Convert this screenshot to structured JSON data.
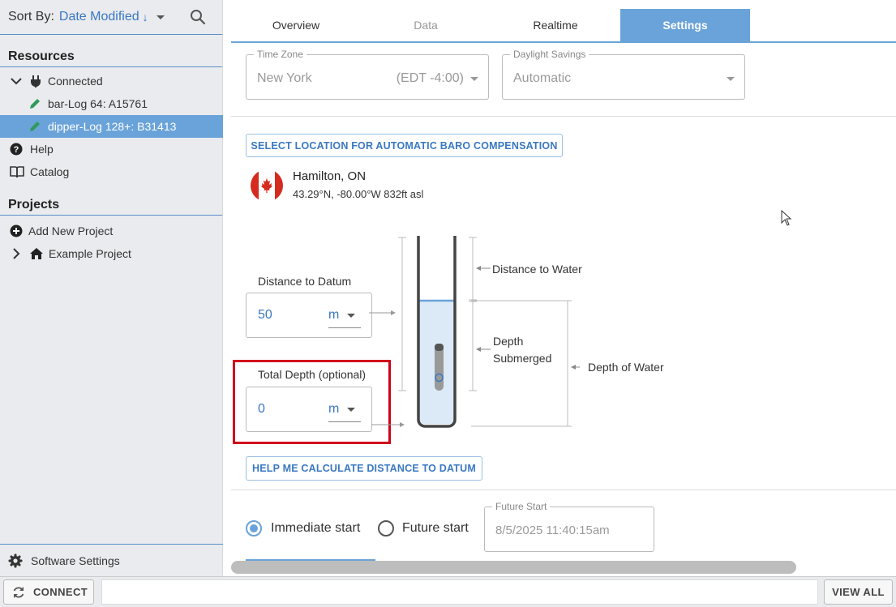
{
  "sidebar": {
    "sort": {
      "label": "Sort By:",
      "value": "Date Modified",
      "direction": "↓"
    },
    "resources_title": "Resources",
    "connected": "Connected",
    "devices": [
      {
        "label": "bar-Log 64: A15761",
        "selected": false
      },
      {
        "label": "dipper-Log 128+: B31413",
        "selected": true
      }
    ],
    "help": "Help",
    "catalog": "Catalog",
    "projects_title": "Projects",
    "add_project": "Add New Project",
    "example_project": "Example Project",
    "software_settings": "Software Settings"
  },
  "tabs": [
    {
      "label": "Overview",
      "state": "normal"
    },
    {
      "label": "Data",
      "state": "disabled"
    },
    {
      "label": "Realtime",
      "state": "normal"
    },
    {
      "label": "Settings",
      "state": "active"
    }
  ],
  "timezone": {
    "legend": "Time Zone",
    "value": "New York",
    "offset": "(EDT -4:00)"
  },
  "daylight": {
    "legend": "Daylight Savings",
    "value": "Automatic"
  },
  "baro_button": "SELECT LOCATION FOR AUTOMATIC BARO COMPENSATION",
  "location": {
    "name": "Hamilton, ON",
    "coords": "43.29°N, -80.00°W 832ft asl"
  },
  "distance_to_datum": {
    "label": "Distance to Datum",
    "value": "50",
    "unit": "m"
  },
  "total_depth": {
    "label": "Total Depth (optional)",
    "value": "0",
    "unit": "m"
  },
  "diagram": {
    "distance_to_water": "Distance to Water",
    "depth_submerged_1": "Depth",
    "depth_submerged_2": "Submerged",
    "depth_of_water": "Depth of Water"
  },
  "help_button": "HELP ME CALCULATE DISTANCE TO DATUM",
  "start": {
    "immediate": "Immediate start",
    "future": "Future start",
    "future_legend": "Future Start",
    "future_value": "8/5/2025 11:40:15am"
  },
  "bottombar": {
    "connect": "CONNECT",
    "view_all": "VIEW ALL"
  }
}
